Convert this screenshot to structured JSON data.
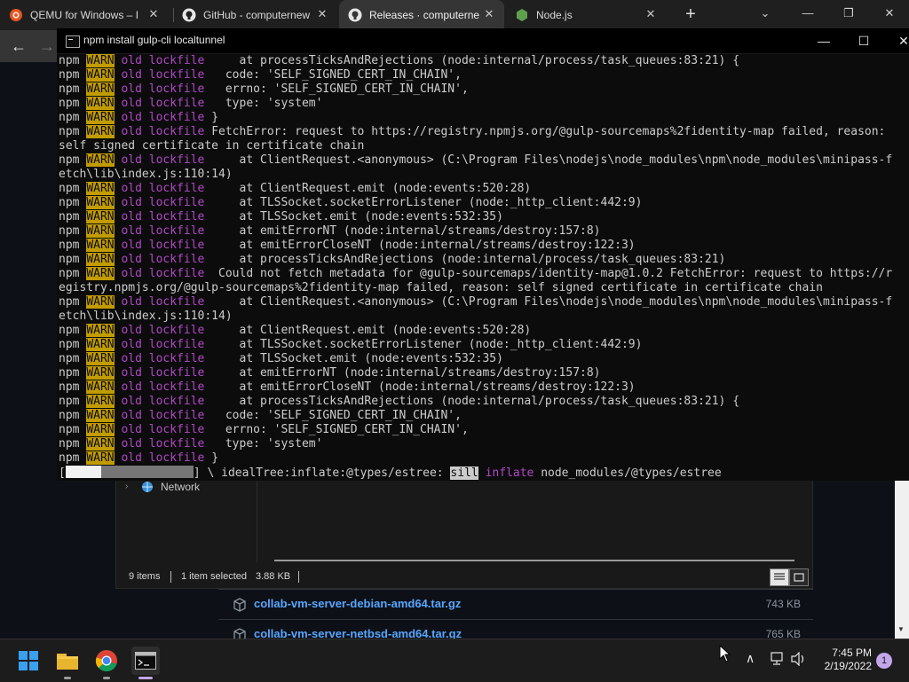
{
  "browser": {
    "tabs": [
      {
        "label": "QEMU for Windows – I",
        "icon": "qemu-icon"
      },
      {
        "label": "GitHub - computernew",
        "icon": "github-icon"
      },
      {
        "label": "Releases · computerne",
        "icon": "github-icon",
        "active": true
      },
      {
        "label": "Node.js",
        "icon": "nodejs-icon"
      }
    ],
    "controls": {
      "new_tab": "+",
      "tab_search": "⌄",
      "minimize": "—",
      "restore": "❐",
      "close": "✕"
    },
    "nav": {
      "back": "←",
      "forward": "→"
    }
  },
  "explorer": {
    "nav_item": "Network",
    "status": {
      "items": "9 items",
      "selected": "1 item selected",
      "size": "3.88 KB"
    }
  },
  "assets": [
    {
      "name": "collab-vm-server-debian-amd64.tar.gz",
      "size": "743 KB"
    },
    {
      "name": "collab-vm-server-netbsd-amd64.tar.gz",
      "size": "765 KB"
    }
  ],
  "console": {
    "title": "npm install gulp-cli localtunnel",
    "controls": {
      "minimize": "—",
      "maximize": "☐",
      "close": "✕"
    },
    "prefix": "npm",
    "warn": "WARN",
    "tag": "old lockfile",
    "lines": [
      {
        "kind": "warn",
        "text": "     at processTicksAndRejections (node:internal/process/task_queues:83:21) {"
      },
      {
        "kind": "warn",
        "text": "   code: 'SELF_SIGNED_CERT_IN_CHAIN',"
      },
      {
        "kind": "warn",
        "text": "   errno: 'SELF_SIGNED_CERT_IN_CHAIN',"
      },
      {
        "kind": "warn",
        "text": "   type: 'system'"
      },
      {
        "kind": "warn",
        "text": " }"
      },
      {
        "kind": "warn",
        "text": " FetchError: request to https://registry.npmjs.org/@gulp-sourcemaps%2fidentity-map failed, reason:"
      },
      {
        "kind": "plain",
        "text": "self signed certificate in certificate chain"
      },
      {
        "kind": "warn",
        "text": "     at ClientRequest.<anonymous> (C:\\Program Files\\nodejs\\node_modules\\npm\\node_modules\\minipass-f"
      },
      {
        "kind": "plain",
        "text": "etch\\lib\\index.js:110:14)"
      },
      {
        "kind": "warn",
        "text": "     at ClientRequest.emit (node:events:520:28)"
      },
      {
        "kind": "warn",
        "text": "     at TLSSocket.socketErrorListener (node:_http_client:442:9)"
      },
      {
        "kind": "warn",
        "text": "     at TLSSocket.emit (node:events:532:35)"
      },
      {
        "kind": "warn",
        "text": "     at emitErrorNT (node:internal/streams/destroy:157:8)"
      },
      {
        "kind": "warn",
        "text": "     at emitErrorCloseNT (node:internal/streams/destroy:122:3)"
      },
      {
        "kind": "warn",
        "text": "     at processTicksAndRejections (node:internal/process/task_queues:83:21)"
      },
      {
        "kind": "warn",
        "text": "  Could not fetch metadata for @gulp-sourcemaps/identity-map@1.0.2 FetchError: request to https://r"
      },
      {
        "kind": "plain",
        "text": "egistry.npmjs.org/@gulp-sourcemaps%2fidentity-map failed, reason: self signed certificate in certificate chain"
      },
      {
        "kind": "warn",
        "text": "     at ClientRequest.<anonymous> (C:\\Program Files\\nodejs\\node_modules\\npm\\node_modules\\minipass-f"
      },
      {
        "kind": "plain",
        "text": "etch\\lib\\index.js:110:14)"
      },
      {
        "kind": "warn",
        "text": "     at ClientRequest.emit (node:events:520:28)"
      },
      {
        "kind": "warn",
        "text": "     at TLSSocket.socketErrorListener (node:_http_client:442:9)"
      },
      {
        "kind": "warn",
        "text": "     at TLSSocket.emit (node:events:532:35)"
      },
      {
        "kind": "warn",
        "text": "     at emitErrorNT (node:internal/streams/destroy:157:8)"
      },
      {
        "kind": "warn",
        "text": "     at emitErrorCloseNT (node:internal/streams/destroy:122:3)"
      },
      {
        "kind": "warn",
        "text": "     at processTicksAndRejections (node:internal/process/task_queues:83:21) {"
      },
      {
        "kind": "warn",
        "text": "   code: 'SELF_SIGNED_CERT_IN_CHAIN',"
      },
      {
        "kind": "warn",
        "text": "   errno: 'SELF_SIGNED_CERT_IN_CHAIN',"
      },
      {
        "kind": "warn",
        "text": "   type: 'system'"
      },
      {
        "kind": "warn",
        "text": " }"
      }
    ],
    "progress": {
      "open": "[",
      "close": "]",
      "spinner": " \\ ",
      "stage": "idealTree:inflate:@types/estree:",
      "level": "sill",
      "action": "inflate",
      "path": "node_modules/@types/estree"
    }
  },
  "taskbar": {
    "apps": [
      {
        "icon": "windows-start-icon"
      },
      {
        "icon": "file-explorer-icon"
      },
      {
        "icon": "chrome-icon"
      },
      {
        "icon": "terminal-icon"
      }
    ],
    "tray": {
      "chevron": "∧",
      "time": "7:45 PM",
      "date": "2/19/2022",
      "notifications": "1"
    }
  },
  "colors": {
    "warn_bg": "#c19c00",
    "magenta": "#b148c6",
    "console_bg": "#0c0c0c",
    "github_link": "#58a6ff"
  }
}
